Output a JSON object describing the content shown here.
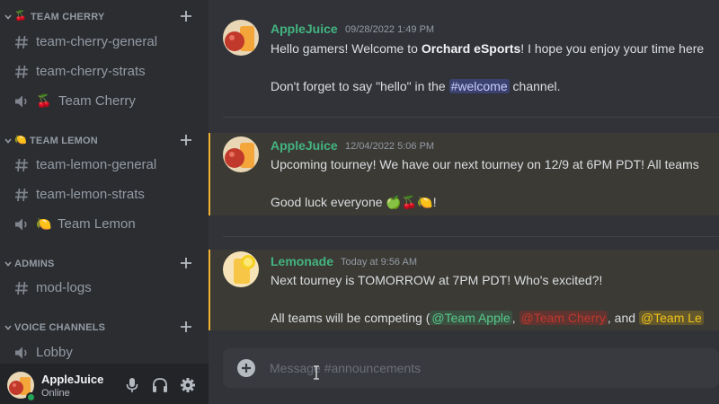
{
  "sidebar": {
    "categories": [
      {
        "label": "TEAM CHERRY",
        "emoji": "🍒"
      },
      {
        "label": "TEAM LEMON",
        "emoji": "🍋"
      },
      {
        "label": "ADMINS"
      },
      {
        "label": "VOICE CHANNELS"
      }
    ],
    "channels": {
      "cherry_general": "team-cherry-general",
      "cherry_strats": "team-cherry-strats",
      "cherry_voice_emoji": "🍒",
      "cherry_voice": "Team Cherry",
      "lemon_general": "team-lemon-general",
      "lemon_strats": "team-lemon-strats",
      "lemon_voice_emoji": "🍋",
      "lemon_voice": "Team Lemon",
      "mod_logs": "mod-logs",
      "lobby": "Lobby"
    }
  },
  "user": {
    "name": "AppleJuice",
    "status": "Online"
  },
  "messages": [
    {
      "author": "AppleJuice",
      "timestamp": "09/28/2022 1:49 PM",
      "line1_a": "Hello gamers! Welcome to ",
      "line1_bold": "Orchard eSports",
      "line1_b": "! I hope you enjoy your time here",
      "line2_a": "Don't forget to say \"hello\" in the ",
      "line2_mention": "#welcome",
      "line2_b": " channel."
    },
    {
      "author": "AppleJuice",
      "timestamp": "12/04/2022 5:06 PM",
      "line1": "Upcoming tourney! We have our next tourney on 12/9 at 6PM PDT! All teams",
      "line2_a": "Good luck everyone ",
      "line2_emoji": "🍏🍒🍋",
      "line2_b": "!"
    },
    {
      "author": "Lemonade",
      "timestamp": "Today at 9:56 AM",
      "line1": "Next tourney is TOMORROW at 7PM PDT! Who's excited?!",
      "line2_a": "All teams will be competing (",
      "mention_apple": "@Team Apple",
      "comma": ",",
      "mention_cherry": "@Team Cherry",
      "and": ", and ",
      "mention_lemon": "@Team Le"
    }
  ],
  "composer": {
    "placeholder": "Message #announcements"
  },
  "colors": {
    "accent_highlight": "#f0b232",
    "author_green": "#43b581",
    "online": "#23a559"
  },
  "icons": [
    "chevron-down-icon",
    "plus-icon",
    "hash-icon",
    "speaker-icon",
    "microphone-icon",
    "headphones-icon",
    "gear-icon",
    "add-circle-icon",
    "text-cursor-icon"
  ]
}
